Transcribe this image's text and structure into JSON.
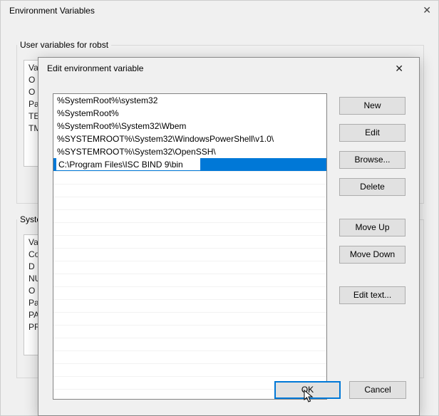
{
  "bg_window": {
    "title": "Environment Variables",
    "sections": {
      "user_legend": "User variables for robst",
      "system_legend": "Syste"
    },
    "user_rows": [
      "Va",
      "O",
      "O",
      "Pa",
      "TE",
      "TM"
    ],
    "system_rows": [
      "Va",
      "Co",
      "D",
      "NU",
      "O",
      "Pa",
      "PA",
      "PR"
    ]
  },
  "fg_window": {
    "title": "Edit environment variable",
    "close_label": "✕",
    "entries": [
      "%SystemRoot%\\system32",
      "%SystemRoot%",
      "%SystemRoot%\\System32\\Wbem",
      "%SYSTEMROOT%\\System32\\WindowsPowerShell\\v1.0\\",
      "%SYSTEMROOT%\\System32\\OpenSSH\\",
      "C:\\Program Files\\ISC BIND 9\\bin"
    ],
    "selected_index": 5,
    "editing_value": "C:\\Program Files\\ISC BIND 9\\bin",
    "buttons": {
      "new": "New",
      "edit": "Edit",
      "browse": "Browse...",
      "delete": "Delete",
      "moveup": "Move Up",
      "movedown": "Move Down",
      "edittext": "Edit text...",
      "ok": "OK",
      "cancel": "Cancel"
    }
  }
}
